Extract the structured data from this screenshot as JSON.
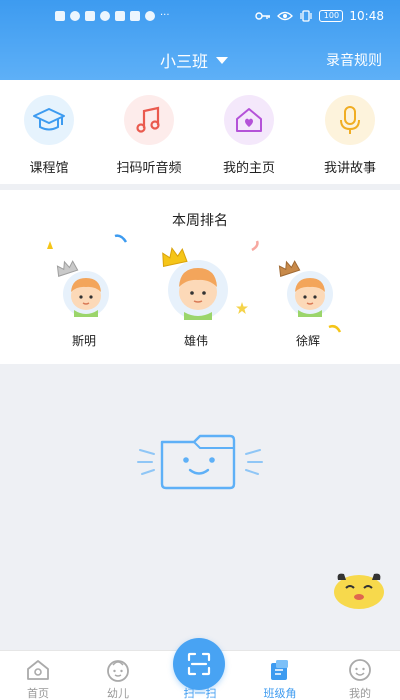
{
  "statusbar": {
    "time": "10:48",
    "battery": "100",
    "dots": "···"
  },
  "header": {
    "class_name": "小三班",
    "rules_link": "录音规则"
  },
  "quick_actions": [
    {
      "label": "课程馆",
      "icon": "graduation-cap-icon"
    },
    {
      "label": "扫码听音频",
      "icon": "music-note-icon"
    },
    {
      "label": "我的主页",
      "icon": "home-heart-icon"
    },
    {
      "label": "我讲故事",
      "icon": "microphone-icon"
    }
  ],
  "ranking": {
    "title": "本周排名",
    "rankers": [
      {
        "name": "斯明",
        "rank": "2"
      },
      {
        "name": "雄伟",
        "rank": "1"
      },
      {
        "name": "徐辉",
        "rank": "3"
      }
    ]
  },
  "bottom_nav": {
    "items": [
      {
        "label": "首页"
      },
      {
        "label": "幼儿"
      },
      {
        "label": "扫一扫"
      },
      {
        "label": "班级角"
      },
      {
        "label": "我的"
      }
    ],
    "active_index": 3
  },
  "colors": {
    "primary": "#3d9bf0",
    "header_light": "#5eb0f7",
    "background": "#eef0f4"
  }
}
